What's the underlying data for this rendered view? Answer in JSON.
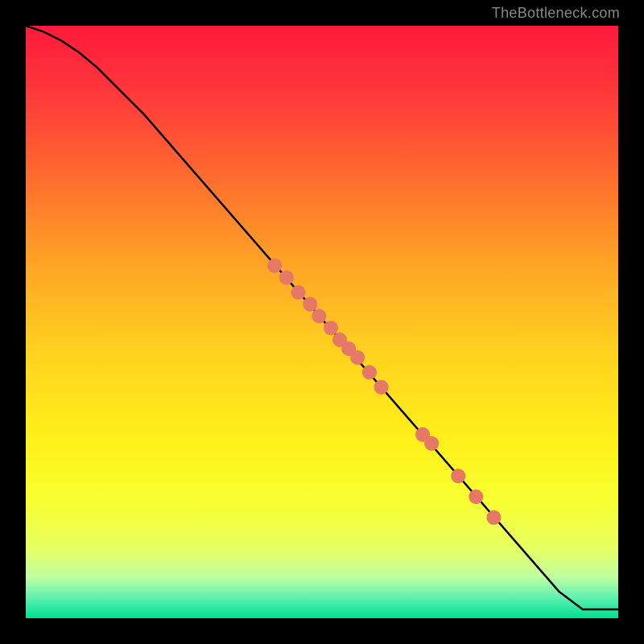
{
  "attribution": "TheBottleneck.com",
  "chart_data": {
    "type": "line",
    "title": "",
    "xlabel": "",
    "ylabel": "",
    "xlim": [
      0,
      100
    ],
    "ylim": [
      0,
      100
    ],
    "grid": false,
    "legend": false,
    "background_gradient": {
      "stops": [
        {
          "pos": 0.0,
          "color": "#ff1a3c"
        },
        {
          "pos": 0.12,
          "color": "#ff3a3a"
        },
        {
          "pos": 0.25,
          "color": "#ff6a2e"
        },
        {
          "pos": 0.4,
          "color": "#ffa326"
        },
        {
          "pos": 0.55,
          "color": "#ffd21f"
        },
        {
          "pos": 0.7,
          "color": "#fff01a"
        },
        {
          "pos": 0.8,
          "color": "#f8ff30"
        },
        {
          "pos": 0.88,
          "color": "#e8ff60"
        },
        {
          "pos": 0.93,
          "color": "#c0ffa0"
        },
        {
          "pos": 0.965,
          "color": "#60f0b0"
        },
        {
          "pos": 1.0,
          "color": "#00e090"
        }
      ]
    },
    "series": [
      {
        "name": "curve",
        "type": "line",
        "color": "#000000",
        "x": [
          0,
          3,
          6,
          9,
          12,
          15,
          20,
          30,
          40,
          50,
          60,
          70,
          80,
          90,
          94,
          100
        ],
        "y": [
          100,
          99,
          97.5,
          95.5,
          93,
          90,
          85,
          73.5,
          62,
          50.5,
          39,
          27.5,
          16,
          4.5,
          1.5,
          1.5
        ]
      },
      {
        "name": "markers",
        "type": "scatter",
        "color": "#e57866",
        "radius": 9,
        "points": [
          {
            "x": 42,
            "y": 59.5
          },
          {
            "x": 44,
            "y": 57.5
          },
          {
            "x": 46,
            "y": 55
          },
          {
            "x": 48,
            "y": 53
          },
          {
            "x": 49.5,
            "y": 51
          },
          {
            "x": 51.5,
            "y": 49
          },
          {
            "x": 53,
            "y": 47
          },
          {
            "x": 54.5,
            "y": 45.5
          },
          {
            "x": 56,
            "y": 44
          },
          {
            "x": 58,
            "y": 41.5
          },
          {
            "x": 60,
            "y": 39
          },
          {
            "x": 67,
            "y": 31
          },
          {
            "x": 68.5,
            "y": 29.5
          },
          {
            "x": 73,
            "y": 24
          },
          {
            "x": 76,
            "y": 20.5
          },
          {
            "x": 79,
            "y": 17
          }
        ]
      }
    ]
  }
}
